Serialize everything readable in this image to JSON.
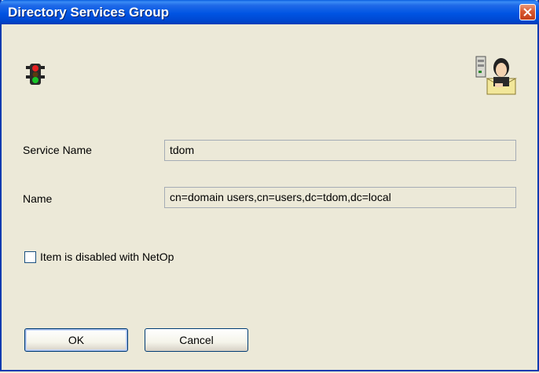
{
  "window": {
    "title": "Directory Services Group"
  },
  "icons": {
    "traffic_light": "traffic-light-icon",
    "directory": "directory-user-icon"
  },
  "form": {
    "service_name_label": "Service Name",
    "service_name_value": "tdom",
    "name_label": "Name",
    "name_value": "cn=domain users,cn=users,dc=tdom,dc=local"
  },
  "checkbox": {
    "label": "Item is disabled with NetOp",
    "checked": false
  },
  "buttons": {
    "ok": "OK",
    "cancel": "Cancel"
  }
}
